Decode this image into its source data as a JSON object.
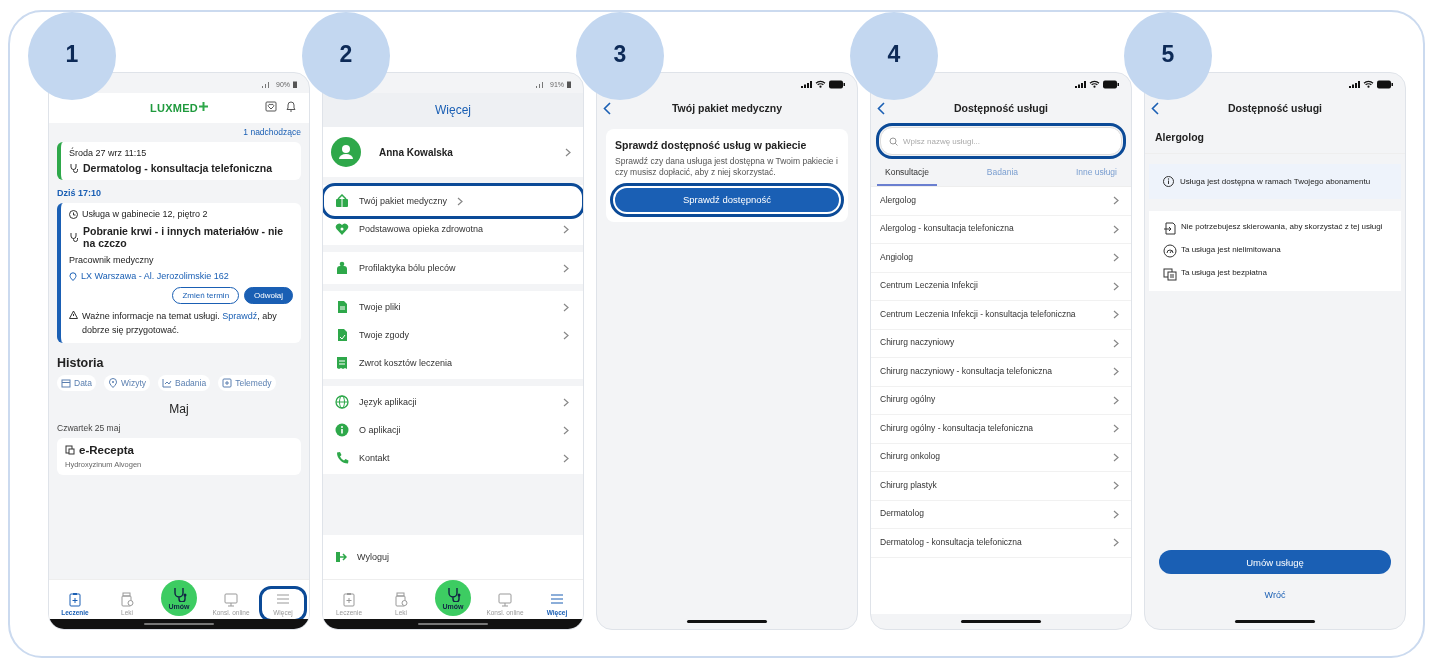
{
  "steps": [
    {
      "number": "1",
      "screen": {
        "kind": "home",
        "status": {
          "kind": "android",
          "battery": "90%"
        },
        "logo": "LUXMED",
        "upcoming": "1 nadchodzące",
        "appointment": {
          "date": "Środa 27 wrz 11:15",
          "title": "Dermatolog - konsultacja telefoniczna"
        },
        "today": "Dziś 17:10",
        "visit": {
          "room": "Usługa w gabinecie 12, piętro 2",
          "title": "Pobranie krwi - i innych materiałów - nie na czczo",
          "staff": "Pracownik medyczny",
          "address": "LX Warszawa - Al. Jerozolimskie 162",
          "actions": [
            {
              "label": "Zmień termin",
              "kind": "outline"
            },
            {
              "label": "Odwołaj",
              "kind": "filled"
            }
          ],
          "notice": {
            "text": "Ważne informacje na temat usługi.",
            "link": "Sprawdź",
            "rest": ", aby dobrze się przygotować."
          }
        },
        "history": {
          "title": "Historia",
          "filters": [
            "Data",
            "Wizyty",
            "Badania",
            "Telemedy"
          ]
        },
        "month": "Maj",
        "day": "Czwartek 25 maj",
        "record": {
          "title": "e-Recepta",
          "subtitle": "Hydroxyzinum Alvogen"
        },
        "nav": [
          {
            "kind": "tab",
            "label": "Leczenie",
            "selected": true,
            "highlighted": false
          },
          {
            "kind": "tab",
            "label": "Leki",
            "selected": false,
            "highlighted": false
          },
          {
            "kind": "fab",
            "label": "Umów",
            "selected": false,
            "highlighted": false
          },
          {
            "kind": "tab",
            "label": "Konsl. online",
            "selected": false,
            "highlighted": false
          },
          {
            "kind": "tab",
            "label": "Więcej",
            "selected": false,
            "highlighted": true
          }
        ]
      }
    },
    {
      "number": "2",
      "screen": {
        "kind": "more",
        "status": {
          "kind": "android",
          "battery": "91%"
        },
        "title": "Więcej",
        "profile": "Anna Kowalska",
        "groups": [
          [
            {
              "label": "Twój pakiet medyczny",
              "highlighted": true,
              "chevron": true
            },
            {
              "label": "Podstawowa opieka zdrowotna",
              "highlighted": false,
              "chevron": true
            }
          ],
          [
            {
              "label": "Profilaktyka bólu pleców",
              "highlighted": false,
              "chevron": true
            }
          ],
          [
            {
              "label": "Twoje pliki",
              "highlighted": false,
              "chevron": true
            },
            {
              "label": "Twoje zgody",
              "highlighted": false,
              "chevron": true
            },
            {
              "label": "Zwrot kosztów leczenia",
              "highlighted": false,
              "chevron": false
            }
          ],
          [
            {
              "label": "Język aplikacji",
              "highlighted": false,
              "chevron": true
            },
            {
              "label": "O aplikacji",
              "highlighted": false,
              "chevron": true
            },
            {
              "label": "Kontakt",
              "highlighted": false,
              "chevron": true
            }
          ]
        ],
        "logout": "Wyloguj",
        "nav": [
          {
            "kind": "tab",
            "label": "Leczenie",
            "selected": false,
            "highlighted": false
          },
          {
            "kind": "tab",
            "label": "Leki",
            "selected": false,
            "highlighted": false
          },
          {
            "kind": "fab",
            "label": "Umów",
            "selected": false,
            "highlighted": false
          },
          {
            "kind": "tab",
            "label": "Konsl. online",
            "selected": false,
            "highlighted": false
          },
          {
            "kind": "tab",
            "label": "Więcej",
            "selected": true,
            "highlighted": false
          }
        ]
      }
    },
    {
      "number": "3",
      "screen": {
        "kind": "package",
        "status": {
          "kind": "ios"
        },
        "title": "Twój pakiet medyczny",
        "card": {
          "heading": "Sprawdź dostępność usług w pakiecie",
          "text": "Sprawdź czy dana usługa jest dostępna w Twoim pakiecie i czy musisz dopłacić, aby z niej skorzystać.",
          "button": {
            "label": "Sprawdź dostępność",
            "highlighted": true
          }
        }
      }
    },
    {
      "number": "4",
      "screen": {
        "kind": "list",
        "status": {
          "kind": "ios"
        },
        "title": "Dostępność usługi",
        "search": {
          "placeholder": "Wpisz nazwę usługi...",
          "highlighted": true
        },
        "tabs": [
          {
            "label": "Konsultacje",
            "selected": true
          },
          {
            "label": "Badania",
            "selected": false
          },
          {
            "label": "Inne usługi",
            "selected": false
          }
        ],
        "items": [
          "Alergolog",
          "Alergolog - konsultacja telefoniczna",
          "Angiolog",
          "Centrum Leczenia Infekcji",
          "Centrum Leczenia Infekcji - konsultacja telefoniczna",
          "Chirurg naczyniowy",
          "Chirurg naczyniowy - konsultacja telefoniczna",
          "Chirurg ogólny",
          "Chirurg ogólny - konsultacja telefoniczna",
          "Chirurg onkolog",
          "Chirurg plastyk",
          "Dermatolog",
          "Dermatolog - konsultacja telefoniczna"
        ]
      }
    },
    {
      "number": "5",
      "screen": {
        "kind": "detail",
        "status": {
          "kind": "ios"
        },
        "title": "Dostępność usługi",
        "service": "Alergolog",
        "info": "Usługa jest dostępna w ramach Twojego abonamentu",
        "features": [
          "Nie potrzebujesz skierowania, aby skorzystać z tej usługi",
          "Ta usługa jest nielimitowana",
          "Ta usługa jest bezpłatna"
        ],
        "button": "Umów usługę",
        "back": "Wróć"
      }
    }
  ]
}
